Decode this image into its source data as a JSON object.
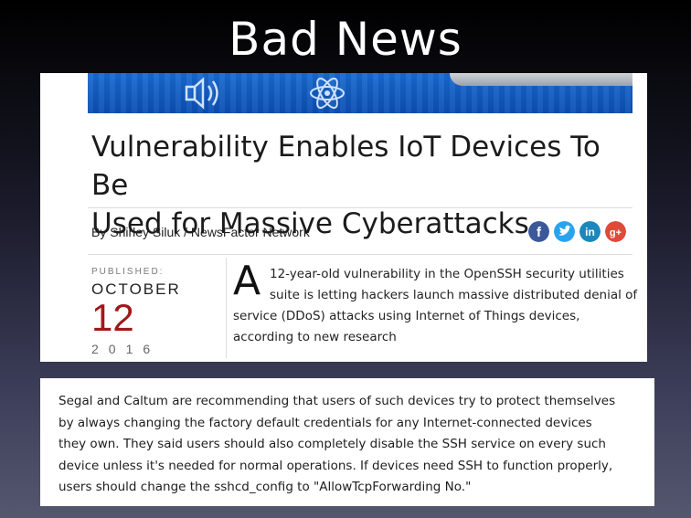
{
  "slide": {
    "title": "Bad News"
  },
  "article": {
    "headline_lines": [
      "Vulnerability Enables IoT Devices To Be",
      "Used for Massive Cyberattacks"
    ],
    "byline": "By Shirley Siluk / NewsFactor Network",
    "social": [
      {
        "name": "facebook",
        "glyph": "f",
        "color": "#3b5998"
      },
      {
        "name": "twitter",
        "glyph": "t",
        "color": "#2aa3ef"
      },
      {
        "name": "linkedin",
        "glyph": "in",
        "color": "#1c87bd"
      },
      {
        "name": "google-plus",
        "glyph": "g+",
        "color": "#dd4b39"
      }
    ],
    "published_label": "PUBLISHED:",
    "month": "OCTOBER",
    "day": "12",
    "year": "2016",
    "dropcap": "A",
    "lede_lines": [
      "12-year-old vulnerability in the OpenSSH security utilities",
      "suite is letting hackers launch massive distributed denial of",
      "service (DDoS) attacks using Internet of Things devices,",
      "according to new research"
    ]
  },
  "quote": {
    "lines": [
      "Segal and Caltum are recommending that users of such devices try to protect themselves",
      "by always changing the factory default credentials for any Internet-connected devices",
      "they own. They said users should also completely disable the SSH service on every such",
      "device unless it's needed for normal operations. If devices need SSH to function properly,",
      "users should change the sshcd_config to \"AllowTcpForwarding No.\""
    ]
  }
}
